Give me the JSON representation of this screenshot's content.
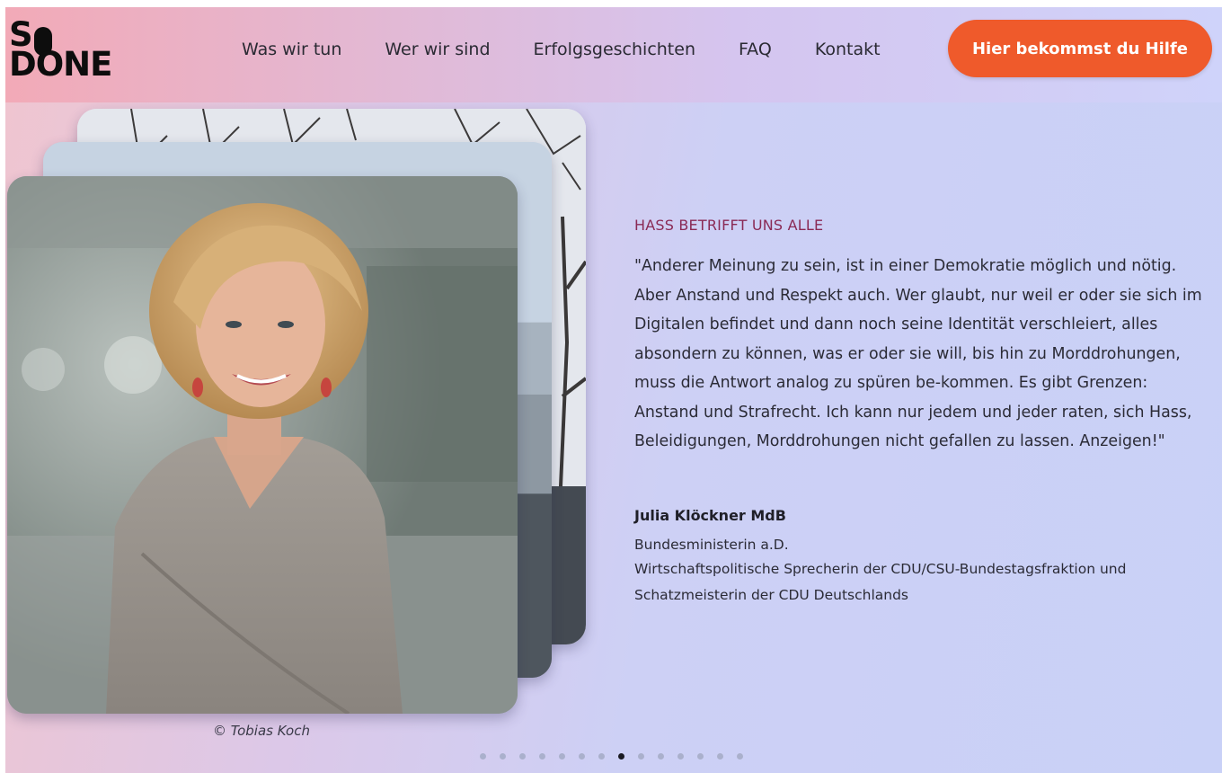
{
  "header": {
    "logo_line1": "S",
    "logo_line2": "DONE",
    "nav": [
      {
        "label": "Was wir tun"
      },
      {
        "label": "Wer wir sind"
      },
      {
        "label": "Erfolgsgeschichten"
      },
      {
        "label": "FAQ"
      },
      {
        "label": "Kontakt"
      }
    ],
    "cta_label": "Hier bekommst du Hilfe"
  },
  "testimonial": {
    "eyebrow": "HASS BETRIFFT UNS ALLE",
    "quote": "\"Anderer Meinung zu sein, ist in einer Demokratie möglich und nötig. Aber Anstand und Respekt auch. Wer glaubt, nur weil er oder sie sich im Digitalen befindet und dann noch seine Identität verschleiert, alles absondern zu können, was er oder sie will, bis hin zu Morddrohungen, muss die Antwort analog zu spüren be-kommen. Es gibt Grenzen: Anstand und Strafrecht. Ich kann nur jedem und jeder raten, sich Hass, Beleidigungen, Morddrohungen nicht gefallen zu lassen. Anzeigen!\"",
    "author": "Julia Klöckner MdB",
    "role_line1": "Bundesministerin a.D.",
    "role_line2": "Wirtschaftspolitische Sprecherin der CDU/CSU-Bundestagsfraktion und",
    "role_line3": "Schatzmeisterin der CDU Deutschlands",
    "photo_credit": "© Tobias Koch"
  },
  "carousel": {
    "total_slides": 14,
    "active_index": 7
  },
  "colors": {
    "accent": "#ef5a2b",
    "eyebrow": "#8a2a55",
    "text": "#2b2b36"
  }
}
